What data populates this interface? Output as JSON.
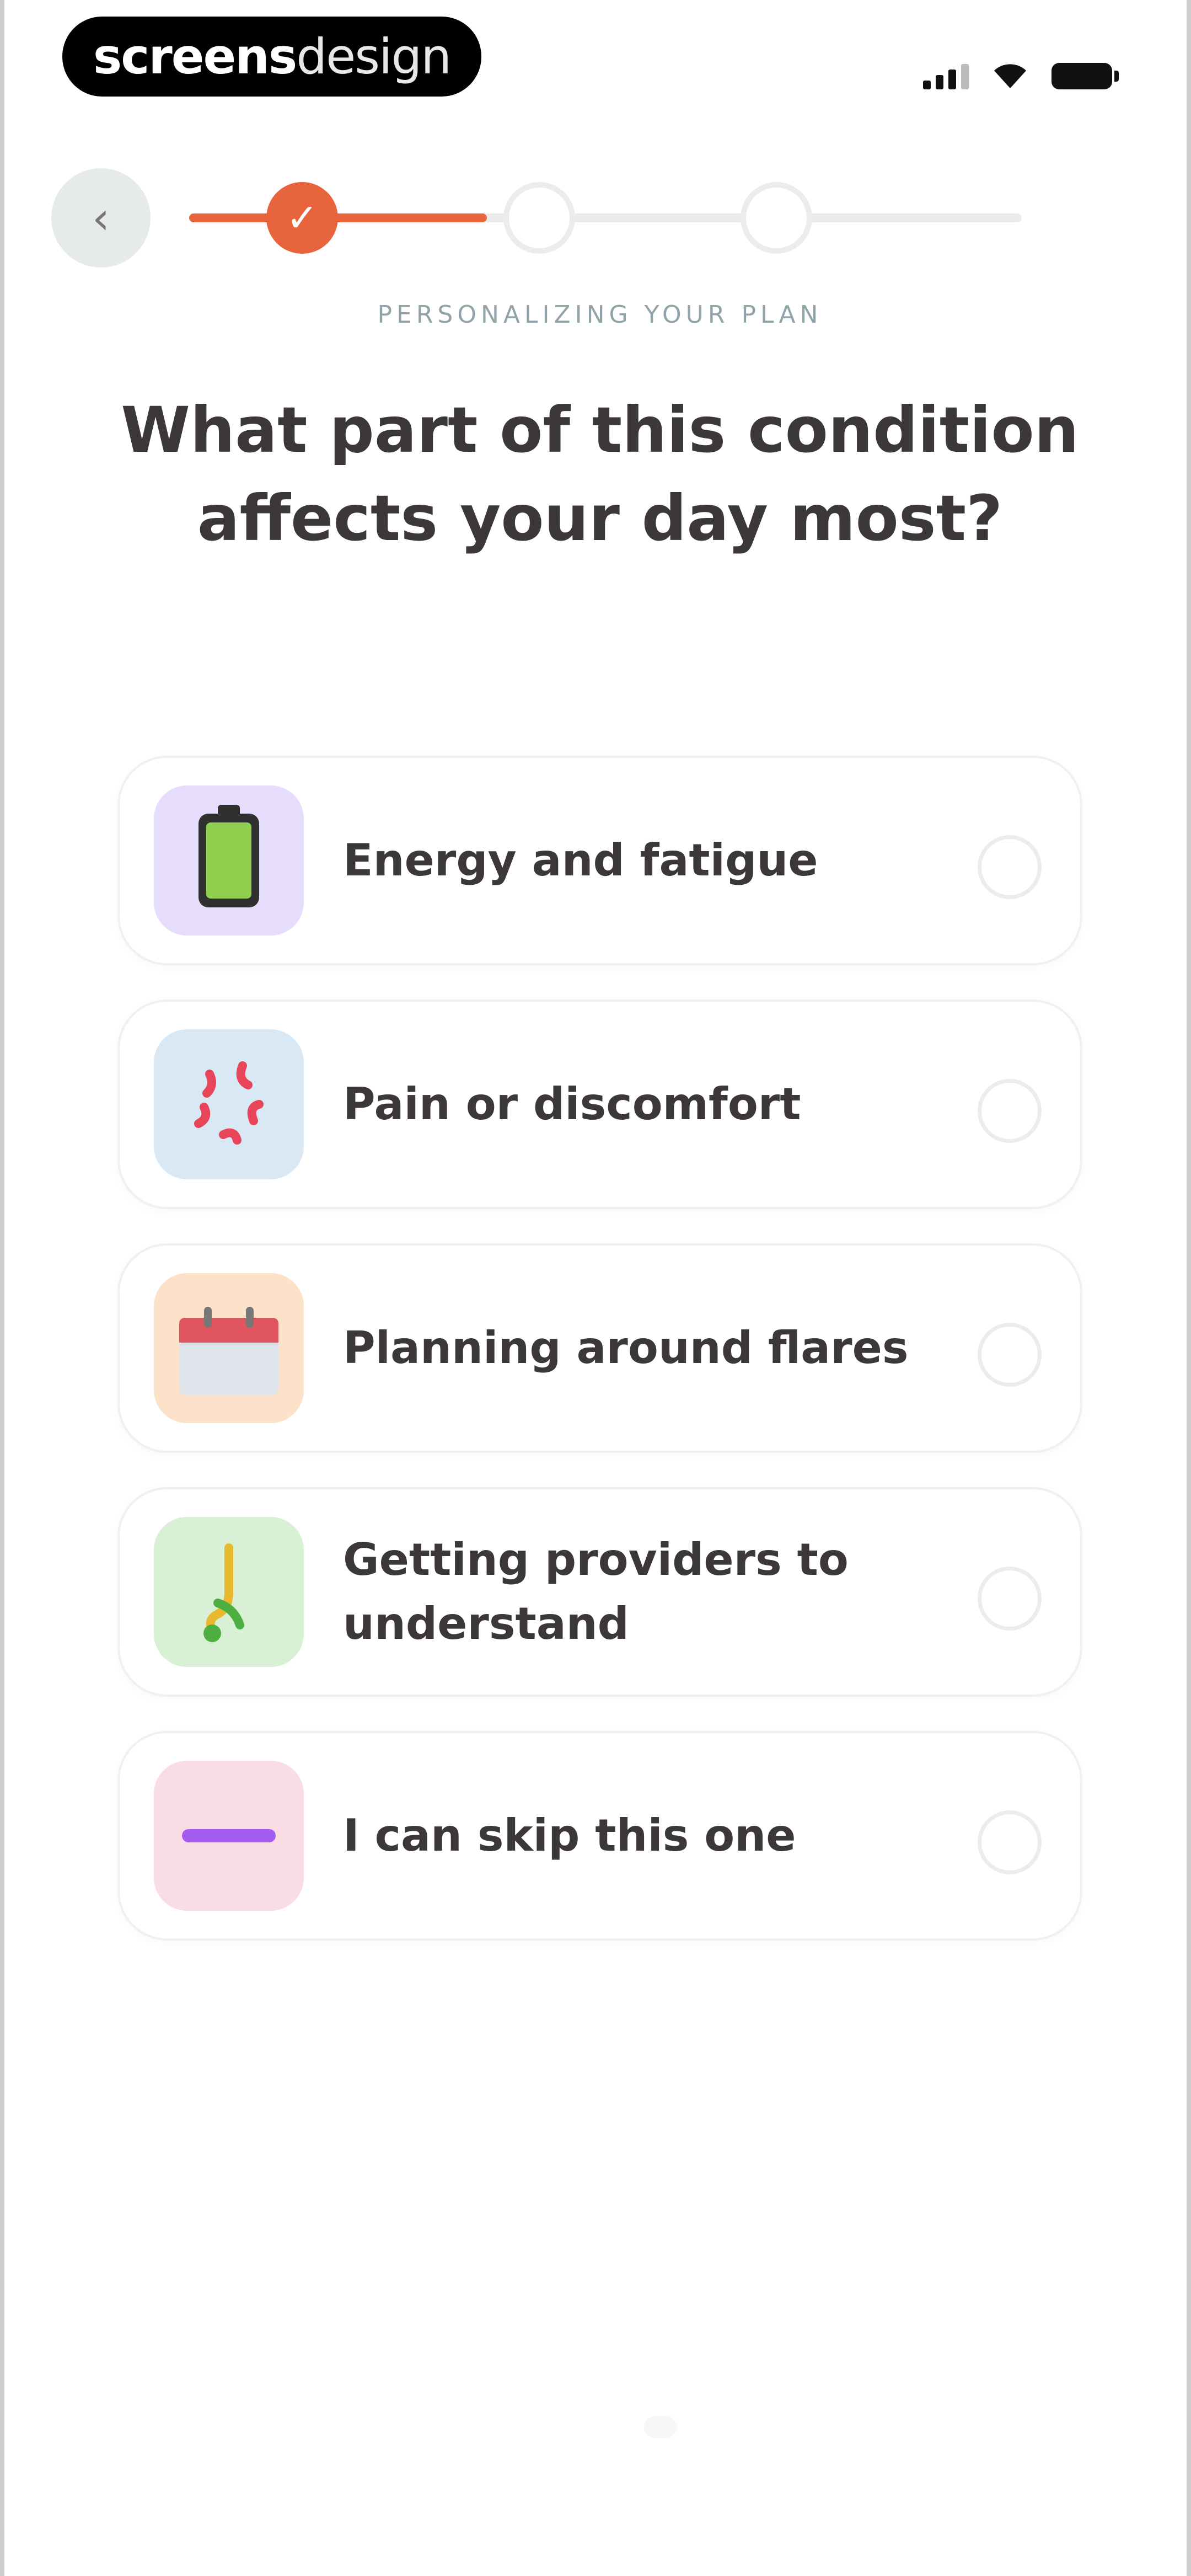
{
  "status_bar": {
    "brand_bold": "screens",
    "brand_light": "design",
    "icons": [
      "signal-icon",
      "wifi-icon",
      "battery-icon"
    ]
  },
  "header": {
    "back_icon": "chevron-left-icon",
    "back_glyph": "‹",
    "progress_steps": 4,
    "current_step": 1,
    "check_glyph": "✓",
    "eyebrow": "PERSONALIZING YOUR PLAN"
  },
  "question": {
    "title": "What part of this condition affects your day most?"
  },
  "options": [
    {
      "label": "Energy and fatigue",
      "icon": "battery-icon",
      "icon_bg": "#e6dcfb",
      "selected": false
    },
    {
      "label": "Pain or discomfort",
      "icon": "pain-burst-icon",
      "icon_bg": "#d9e8f5",
      "selected": false
    },
    {
      "label": "Planning around flares",
      "icon": "calendar-icon",
      "icon_bg": "#fbe2c8",
      "selected": false
    },
    {
      "label": "Getting providers to understand",
      "icon": "stethoscope-icon",
      "icon_bg": "#d8f0d4",
      "selected": false
    },
    {
      "label": "I can skip this one",
      "icon": "dash-icon",
      "icon_bg": "#fadce4",
      "selected": false
    }
  ],
  "colors": {
    "accent": "#e8643c",
    "text": "#3d3838",
    "eyebrow": "#8fa3a8"
  }
}
